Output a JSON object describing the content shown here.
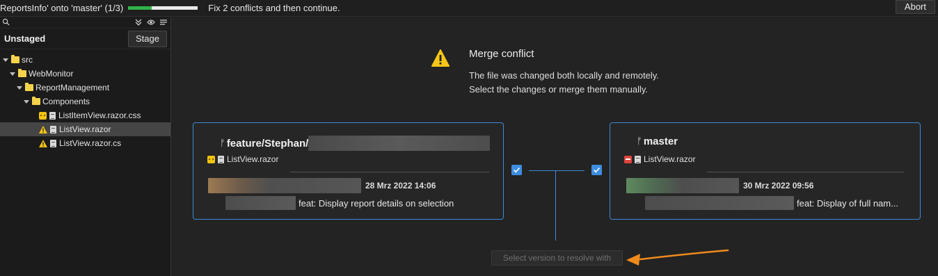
{
  "topbar": {
    "title": "ReportsInfo' onto 'master' (1/3)",
    "progress": 0.333,
    "status": "Fix 2 conflicts and then continue.",
    "abort_label": "Abort"
  },
  "sidebar": {
    "toolbar_icons": [
      "search-icon",
      "collapse-all-icon",
      "eye-icon",
      "list-view-icon"
    ],
    "unstaged_label": "Unstaged",
    "stage_label": "Stage",
    "tree": [
      {
        "label": "src",
        "kind": "folder",
        "depth": 0
      },
      {
        "label": "WebMonitor",
        "kind": "folder",
        "depth": 1
      },
      {
        "label": "ReportManagement",
        "kind": "folder",
        "depth": 2
      },
      {
        "label": "Components",
        "kind": "folder",
        "depth": 3
      },
      {
        "label": "ListItemView.razor.css",
        "kind": "file",
        "depth": 4,
        "status": "modified"
      },
      {
        "label": "ListView.razor",
        "kind": "file",
        "depth": 4,
        "status": "conflict",
        "selected": true
      },
      {
        "label": "ListView.razor.cs",
        "kind": "file",
        "depth": 4,
        "status": "conflict"
      }
    ]
  },
  "conflict": {
    "title": "Merge conflict",
    "desc_line1": "The file was changed both locally and remotely.",
    "desc_line2": "Select the changes or merge them manually."
  },
  "local": {
    "branch": "feature/Stephan/",
    "file": "ListView.razor",
    "file_status": "modified",
    "date": "28 Mrz 2022 14:06",
    "message": "feat: Display report details on selection",
    "checked": true
  },
  "remote": {
    "branch": "master",
    "file": "ListView.razor",
    "file_status": "deleted",
    "date": "30 Mrz 2022 09:56",
    "message": "feat: Display of full nam...",
    "checked": true
  },
  "resolve_button": {
    "label": "Select version to resolve with",
    "enabled": false
  },
  "colors": {
    "accent": "#3c8bd8",
    "progress": "#2fb34a",
    "warning": "#f5c518",
    "deleted": "#e0433c",
    "annotation_arrow": "#f08a1c"
  }
}
